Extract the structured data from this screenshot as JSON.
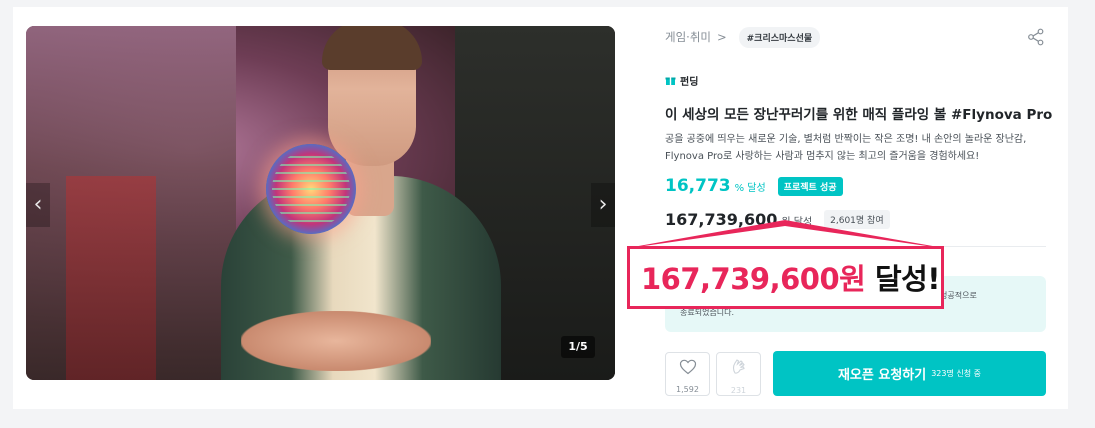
{
  "gallery": {
    "counter": "1/5",
    "prev_arrow": "‹",
    "next_arrow": "›"
  },
  "breadcrumb": {
    "category": "게임·취미",
    "separator": ">",
    "tag": "#크리스마스선물"
  },
  "project": {
    "type_label": "펀딩",
    "title": "이 세상의 모든 장난꾸러기를 위한 매직 플라잉 볼 #Flynova Pro",
    "description": "공을 공중에 띄우는 새로운 기술, 별처럼 반짝이는 작은 조명! 내 손안의 놀라운 장난감, Flynova Pro로 사랑하는 사람과 멈추지 않는 최고의 즐거움을 경험하세요!",
    "rate_value": "16,773",
    "rate_unit": "% 달성",
    "success_badge": "프로젝트 성공",
    "amount_value": "167,739,600",
    "amount_unit": "원 달성",
    "participants": "2,601명 참여"
  },
  "notice": {
    "line1": "성공적으로",
    "line2": "종료되었습니다."
  },
  "actions": {
    "like_count": "1,592",
    "cheer_count": "231",
    "request_label": "재오픈 요청하기",
    "request_sub": "323명 신청 중"
  },
  "callout": {
    "amount": "167,739,600원",
    "suffix": "달성!"
  },
  "colors": {
    "accent": "#00c4c4",
    "callout_red": "#e8265a"
  }
}
